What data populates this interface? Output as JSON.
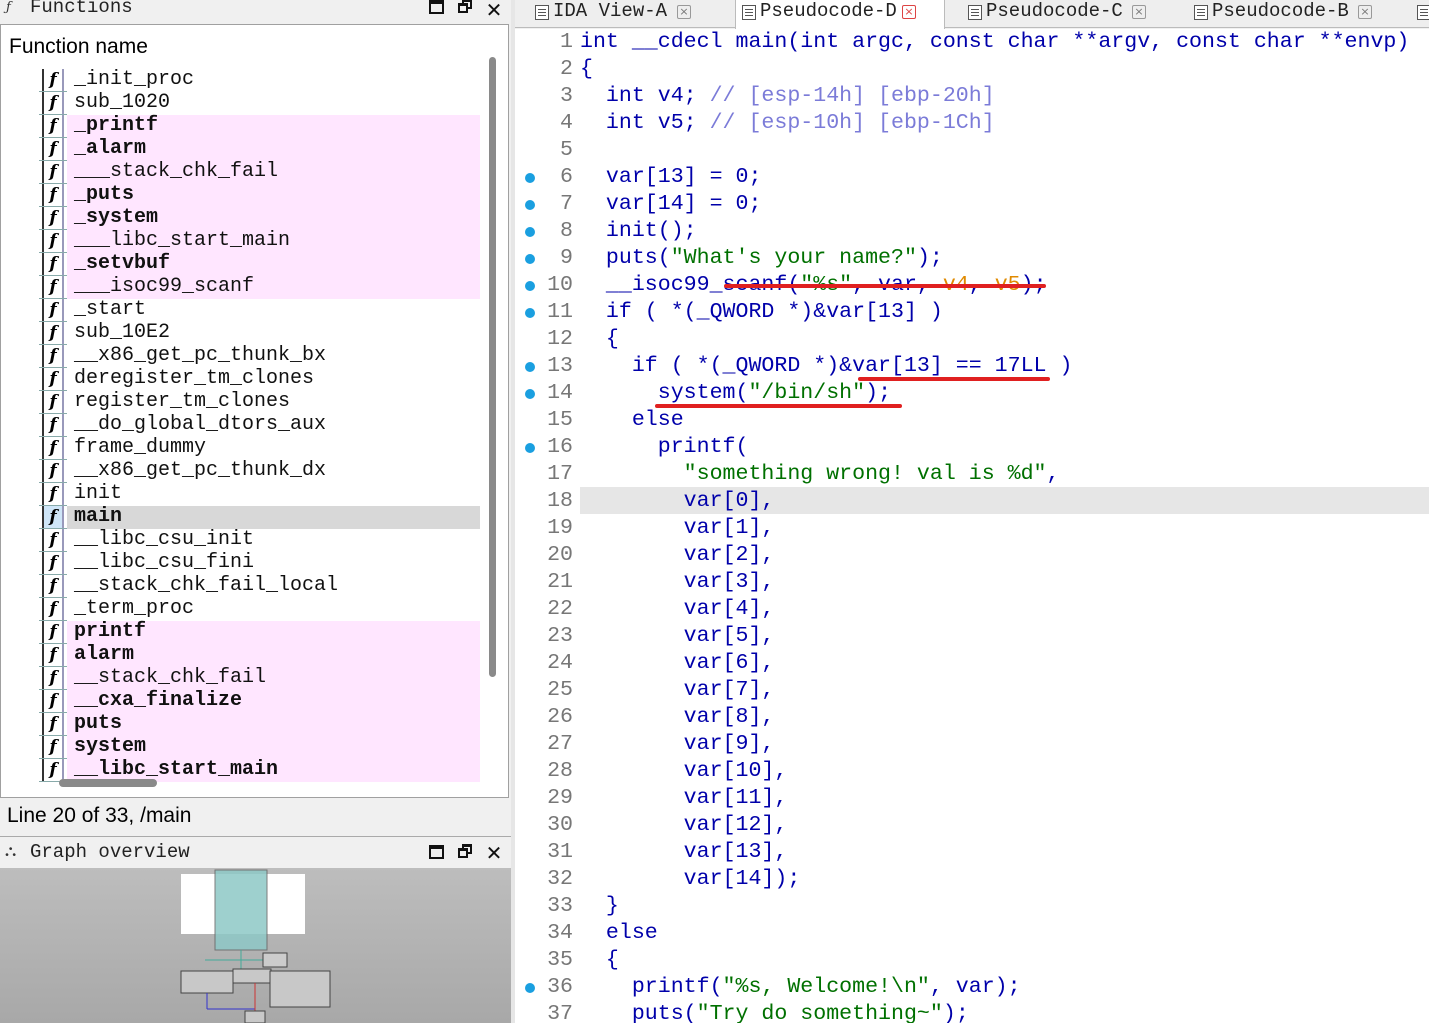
{
  "functions_panel": {
    "title": "Functions",
    "column_header": "Function name",
    "items": [
      {
        "name": "_init_proc",
        "kind": "normal"
      },
      {
        "name": "sub_1020",
        "kind": "normal"
      },
      {
        "name": "_printf",
        "kind": "lib"
      },
      {
        "name": "_alarm",
        "kind": "lib"
      },
      {
        "name": "___stack_chk_fail",
        "kind": "lib"
      },
      {
        "name": "_puts",
        "kind": "lib"
      },
      {
        "name": "_system",
        "kind": "lib"
      },
      {
        "name": "___libc_start_main",
        "kind": "lib"
      },
      {
        "name": "_setvbuf",
        "kind": "lib"
      },
      {
        "name": "___isoc99_scanf",
        "kind": "lib"
      },
      {
        "name": "_start",
        "kind": "normal"
      },
      {
        "name": "sub_10E2",
        "kind": "normal"
      },
      {
        "name": "__x86_get_pc_thunk_bx",
        "kind": "normal"
      },
      {
        "name": "deregister_tm_clones",
        "kind": "normal"
      },
      {
        "name": "register_tm_clones",
        "kind": "normal"
      },
      {
        "name": "__do_global_dtors_aux",
        "kind": "normal"
      },
      {
        "name": "frame_dummy",
        "kind": "normal"
      },
      {
        "name": "__x86_get_pc_thunk_dx",
        "kind": "normal"
      },
      {
        "name": "init",
        "kind": "normal"
      },
      {
        "name": "main",
        "kind": "selected"
      },
      {
        "name": "__libc_csu_init",
        "kind": "normal"
      },
      {
        "name": "__libc_csu_fini",
        "kind": "normal"
      },
      {
        "name": "__stack_chk_fail_local",
        "kind": "normal"
      },
      {
        "name": "_term_proc",
        "kind": "normal"
      },
      {
        "name": "printf",
        "kind": "lib"
      },
      {
        "name": "alarm",
        "kind": "lib"
      },
      {
        "name": "__stack_chk_fail",
        "kind": "lib"
      },
      {
        "name": "__cxa_finalize",
        "kind": "lib"
      },
      {
        "name": "puts",
        "kind": "lib"
      },
      {
        "name": "system",
        "kind": "lib"
      },
      {
        "name": "__libc_start_main",
        "kind": "lib"
      }
    ]
  },
  "status_line": "Line 20 of 33, /main",
  "graph_overview": {
    "title": "Graph overview"
  },
  "tabs": [
    {
      "label": "IDA View-A",
      "active": false
    },
    {
      "label": "Pseudocode-D",
      "active": true
    },
    {
      "label": "Pseudocode-C",
      "active": false
    },
    {
      "label": "Pseudocode-B",
      "active": false
    }
  ],
  "code_lines": [
    {
      "n": "1",
      "bp": false,
      "tokens": [
        [
          "kw",
          "int __cdecl main(int argc, const char **argv, const char **envp)"
        ]
      ]
    },
    {
      "n": "2",
      "bp": false,
      "tokens": [
        [
          "kw",
          "{"
        ]
      ]
    },
    {
      "n": "3",
      "bp": false,
      "tokens": [
        [
          "kw",
          "  int v4; "
        ],
        [
          "cmt",
          "// [esp-14h] [ebp-20h]"
        ]
      ]
    },
    {
      "n": "4",
      "bp": false,
      "tokens": [
        [
          "kw",
          "  int v5; "
        ],
        [
          "cmt",
          "// [esp-10h] [ebp-1Ch]"
        ]
      ]
    },
    {
      "n": "5",
      "bp": false,
      "tokens": []
    },
    {
      "n": "6",
      "bp": true,
      "tokens": [
        [
          "kw",
          "  var[13] = 0;"
        ]
      ]
    },
    {
      "n": "7",
      "bp": true,
      "tokens": [
        [
          "kw",
          "  var[14] = 0;"
        ]
      ]
    },
    {
      "n": "8",
      "bp": true,
      "tokens": [
        [
          "kw",
          "  init();"
        ]
      ]
    },
    {
      "n": "9",
      "bp": true,
      "tokens": [
        [
          "kw",
          "  puts("
        ],
        [
          "str",
          "\"What's your name?\""
        ],
        [
          "kw",
          ");"
        ]
      ]
    },
    {
      "n": "10",
      "bp": true,
      "tokens": [
        [
          "kw",
          "  __isoc99_scanf("
        ],
        [
          "str",
          "\"%s\""
        ],
        [
          "kw",
          ", var, "
        ],
        [
          "var",
          "v4"
        ],
        [
          "kw",
          ", "
        ],
        [
          "var",
          "v5"
        ],
        [
          "kw",
          ");"
        ]
      ]
    },
    {
      "n": "11",
      "bp": true,
      "tokens": [
        [
          "kw",
          "  if ( *(_QWORD *)&var[13] )"
        ]
      ]
    },
    {
      "n": "12",
      "bp": false,
      "tokens": [
        [
          "kw",
          "  {"
        ]
      ]
    },
    {
      "n": "13",
      "bp": true,
      "tokens": [
        [
          "kw",
          "    if ( *(_QWORD *)&var[13] == 17LL )"
        ]
      ]
    },
    {
      "n": "14",
      "bp": true,
      "tokens": [
        [
          "kw",
          "      system("
        ],
        [
          "str",
          "\"/bin/sh\""
        ],
        [
          "kw",
          ");"
        ]
      ]
    },
    {
      "n": "15",
      "bp": false,
      "tokens": [
        [
          "kw",
          "    else"
        ]
      ]
    },
    {
      "n": "16",
      "bp": true,
      "tokens": [
        [
          "kw",
          "      printf("
        ]
      ]
    },
    {
      "n": "17",
      "bp": false,
      "tokens": [
        [
          "kw",
          "        "
        ],
        [
          "str",
          "\"something wrong! val is %d\""
        ],
        [
          "kw",
          ","
        ]
      ]
    },
    {
      "n": "18",
      "bp": false,
      "tokens": [
        [
          "kw",
          "        var[0],"
        ]
      ]
    },
    {
      "n": "19",
      "bp": false,
      "tokens": [
        [
          "kw",
          "        var[1],"
        ]
      ]
    },
    {
      "n": "20",
      "bp": false,
      "tokens": [
        [
          "kw",
          "        var[2],"
        ]
      ]
    },
    {
      "n": "21",
      "bp": false,
      "tokens": [
        [
          "kw",
          "        var[3],"
        ]
      ]
    },
    {
      "n": "22",
      "bp": false,
      "tokens": [
        [
          "kw",
          "        var[4],"
        ]
      ]
    },
    {
      "n": "23",
      "bp": false,
      "tokens": [
        [
          "kw",
          "        var[5],"
        ]
      ]
    },
    {
      "n": "24",
      "bp": false,
      "tokens": [
        [
          "kw",
          "        var[6],"
        ]
      ]
    },
    {
      "n": "25",
      "bp": false,
      "tokens": [
        [
          "kw",
          "        var[7],"
        ]
      ]
    },
    {
      "n": "26",
      "bp": false,
      "tokens": [
        [
          "kw",
          "        var[8],"
        ]
      ]
    },
    {
      "n": "27",
      "bp": false,
      "tokens": [
        [
          "kw",
          "        var[9],"
        ]
      ]
    },
    {
      "n": "28",
      "bp": false,
      "tokens": [
        [
          "kw",
          "        var[10],"
        ]
      ]
    },
    {
      "n": "29",
      "bp": false,
      "tokens": [
        [
          "kw",
          "        var[11],"
        ]
      ]
    },
    {
      "n": "30",
      "bp": false,
      "tokens": [
        [
          "kw",
          "        var[12],"
        ]
      ]
    },
    {
      "n": "31",
      "bp": false,
      "tokens": [
        [
          "kw",
          "        var[13],"
        ]
      ]
    },
    {
      "n": "32",
      "bp": false,
      "tokens": [
        [
          "kw",
          "        var[14]);"
        ]
      ]
    },
    {
      "n": "33",
      "bp": false,
      "tokens": [
        [
          "kw",
          "  }"
        ]
      ]
    },
    {
      "n": "34",
      "bp": false,
      "tokens": [
        [
          "kw",
          "  else"
        ]
      ]
    },
    {
      "n": "35",
      "bp": false,
      "tokens": [
        [
          "kw",
          "  {"
        ]
      ]
    },
    {
      "n": "36",
      "bp": true,
      "tokens": [
        [
          "kw",
          "    printf("
        ],
        [
          "str",
          "\"%s, Welcome!\\n\""
        ],
        [
          "kw",
          ", var);"
        ]
      ]
    },
    {
      "n": "37",
      "bp": false,
      "tokens": [
        [
          "kw",
          "    puts("
        ],
        [
          "str",
          "\"Try do something~\""
        ],
        [
          "kw",
          ");"
        ]
      ]
    }
  ],
  "colors": {
    "keyword": "#0000aa",
    "string": "#007000",
    "comment": "#7b7bd8",
    "variable": "#e08a00",
    "lib_function_bg": "#ffe6ff",
    "annotation": "#e02020"
  }
}
